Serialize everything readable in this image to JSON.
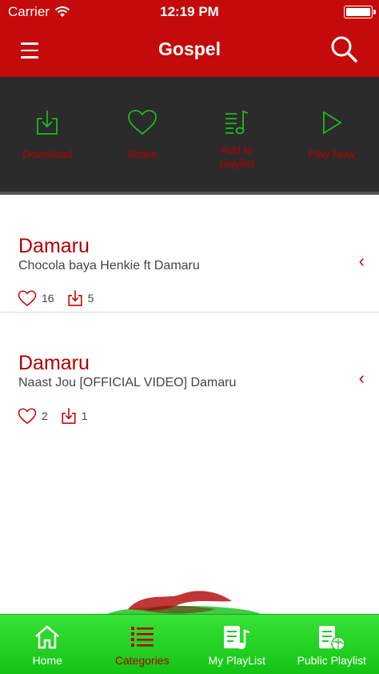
{
  "status_bar": {
    "carrier": "Carrier",
    "time": "12:19 PM"
  },
  "nav": {
    "title": "Gospel",
    "menu_icon": "hamburger-icon",
    "search_icon": "search-icon"
  },
  "actions": [
    {
      "label": "Download",
      "icon": "download-icon"
    },
    {
      "label": "Share",
      "icon": "heart-icon"
    },
    {
      "label": "Add to playlist",
      "icon": "playlist-add-icon"
    },
    {
      "label": "Play Now",
      "icon": "play-icon"
    }
  ],
  "songs": [
    {
      "artist": "Damaru",
      "title": "Chocola baya Henkie ft Damaru",
      "likes": "16",
      "downloads": "5",
      "chevron": "‹"
    },
    {
      "artist": "Damaru",
      "title": "Naast Jou [OFFICIAL VIDEO] Damaru",
      "likes": "2",
      "downloads": "1",
      "chevron": "‹"
    }
  ],
  "tabs": [
    {
      "label": "Home",
      "icon": "home-icon",
      "active": false
    },
    {
      "label": "Categories",
      "icon": "categories-icon",
      "active": true
    },
    {
      "label": "My PlayList",
      "icon": "my-playlist-icon",
      "active": false
    },
    {
      "label": "Public Playlist",
      "icon": "public-playlist-icon",
      "active": false
    }
  ],
  "colors": {
    "brand_red": "#c40a0a",
    "action_green": "#1fb81f",
    "tab_green": "#22d322",
    "tray_bg": "#2b2b2b"
  }
}
